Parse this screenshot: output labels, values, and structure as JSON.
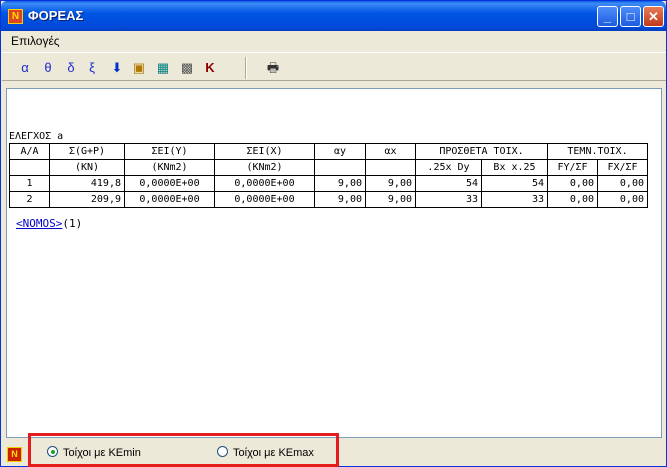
{
  "window": {
    "title": "ΦΟΡΕΑΣ",
    "app_icon": "app-icon-n",
    "controls": [
      "minimize",
      "maximize",
      "close"
    ]
  },
  "menu": {
    "items": [
      "Επιλογές"
    ]
  },
  "toolbar": {
    "buttons": [
      {
        "name": "alpha",
        "label": "α"
      },
      {
        "name": "theta",
        "label": "θ"
      },
      {
        "name": "delta",
        "label": "δ"
      },
      {
        "name": "xi",
        "label": "ξ"
      },
      {
        "name": "download",
        "label": "⬇"
      },
      {
        "name": "properties",
        "label": "▣"
      },
      {
        "name": "select",
        "label": "▦"
      },
      {
        "name": "grid",
        "label": "▩"
      },
      {
        "name": "k",
        "label": "K"
      },
      {
        "name": "print",
        "label": "🖶"
      }
    ]
  },
  "report": {
    "title": "ΕΛΕΓΧΟΣ a",
    "headers1": [
      "Α/Α",
      "Σ(G+P)",
      "ΣΕΙ(Y)",
      "ΣΕΙ(X)",
      "αy",
      "αx",
      "ΠΡΟΣΘΕΤΑ ΤΟΙΧ.",
      "ΤΕΜΝ.ΤΟΙΧ."
    ],
    "headers2": [
      "",
      "(KN)",
      "(KNm2)",
      "(KNm2)",
      "",
      "",
      ".25x Dy",
      "Bx x.25",
      "FY/ΣF",
      "FX/ΣF"
    ],
    "rows": [
      [
        "1",
        "419,8",
        "0,0000E+00",
        "0,0000E+00",
        "9,00",
        "9,00",
        "54",
        "54",
        "0,00",
        "0,00"
      ],
      [
        "2",
        "209,9",
        "0,0000E+00",
        "0,0000E+00",
        "9,00",
        "9,00",
        "33",
        "33",
        "0,00",
        "0,00"
      ]
    ],
    "link_text": "<NOMOS>",
    "link_suffix": "(1)"
  },
  "status": {
    "icon": "app-icon-n",
    "radio_min": {
      "label": "Τοίχοι με ΚΕmin",
      "checked": true
    },
    "radio_max": {
      "label": "Τοίχοι με ΚΕmax",
      "checked": false
    },
    "highlight_color": "#e41c1c"
  }
}
